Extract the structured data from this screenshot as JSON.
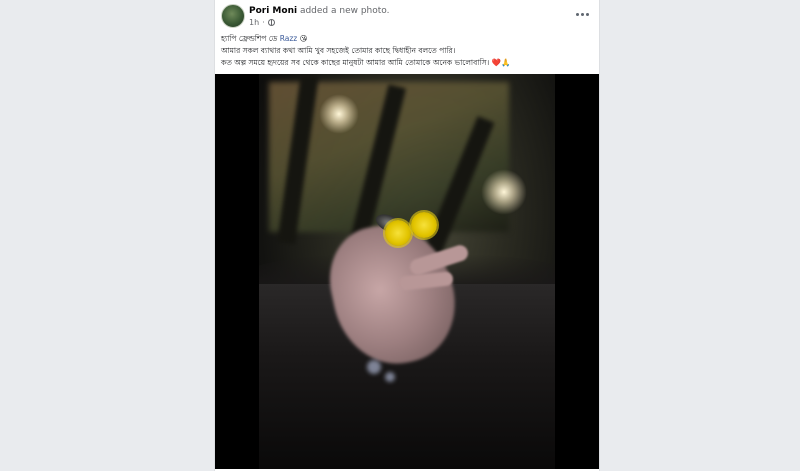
{
  "post": {
    "author_name": "Pori Moni",
    "action": "added a new photo.",
    "time": "1h",
    "text_line1_prefix": "হ্যাপি ফ্রেন্ডশিপ ডে ",
    "mention": "Razz",
    "text_line1_emoji": "😘",
    "text_line2": "আমার সকল ব্যাথার কথা আমি খুব সহজেই তোমার কাছে দ্বিধাহীন বলতে পারি।",
    "text_line3": "কত অল্প সময়ে হৃদয়ের সব থেকে কাছের মানুষটা আমার আমি তোমাকে অনেক ভালোবাসি। ❤️🙏"
  },
  "icons": {
    "privacy": "globe-icon",
    "more": "more-options-icon"
  },
  "colors": {
    "page_background": "#e9ebee",
    "card_background": "#ffffff",
    "mention_link": "#385898"
  }
}
